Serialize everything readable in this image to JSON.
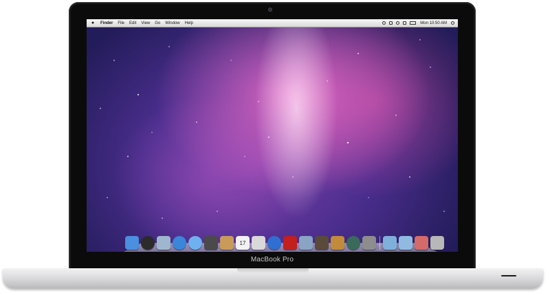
{
  "device": {
    "brand_label": "MacBook Pro"
  },
  "menubar": {
    "apple_icon": "apple-logo-icon",
    "items": [
      "Finder",
      "File",
      "Edit",
      "View",
      "Go",
      "Window",
      "Help"
    ],
    "status_icons": [
      "time-machine-icon",
      "bluetooth-icon",
      "wifi-icon",
      "volume-icon",
      "battery-icon"
    ],
    "clock": "Mon 10:50 AM",
    "spotlight_icon": "spotlight-search-icon"
  },
  "dock": {
    "apps": [
      {
        "name": "finder-icon",
        "color": "#4a8fe0"
      },
      {
        "name": "dashboard-icon",
        "color": "#2b2b2b"
      },
      {
        "name": "mail-icon",
        "color": "#9fb6cf"
      },
      {
        "name": "safari-icon",
        "color": "#3b86d8"
      },
      {
        "name": "ichat-icon",
        "color": "#6fb1f0"
      },
      {
        "name": "facetime-icon",
        "color": "#4a4a4a"
      },
      {
        "name": "address-book-icon",
        "color": "#c99b5a"
      },
      {
        "name": "ical-icon",
        "color": "#f2f2f2",
        "label": "17"
      },
      {
        "name": "preview-icon",
        "color": "#d9d9d9"
      },
      {
        "name": "itunes-icon",
        "color": "#2f6fd1"
      },
      {
        "name": "photo-booth-icon",
        "color": "#c21f1f"
      },
      {
        "name": "iphoto-icon",
        "color": "#8aa4c4"
      },
      {
        "name": "imovie-icon",
        "color": "#5a4a3a"
      },
      {
        "name": "garageband-icon",
        "color": "#c28b3a"
      },
      {
        "name": "time-machine-icon",
        "color": "#3a6a5a"
      },
      {
        "name": "system-preferences-icon",
        "color": "#8d8d8d"
      }
    ],
    "stacks": [
      {
        "name": "applications-folder-icon",
        "color": "#7fb0dc"
      },
      {
        "name": "documents-folder-icon",
        "color": "#8fbbe3"
      },
      {
        "name": "downloads-stack-icon",
        "color": "#d46a6a"
      },
      {
        "name": "trash-icon",
        "color": "#b8b8b8"
      }
    ]
  }
}
